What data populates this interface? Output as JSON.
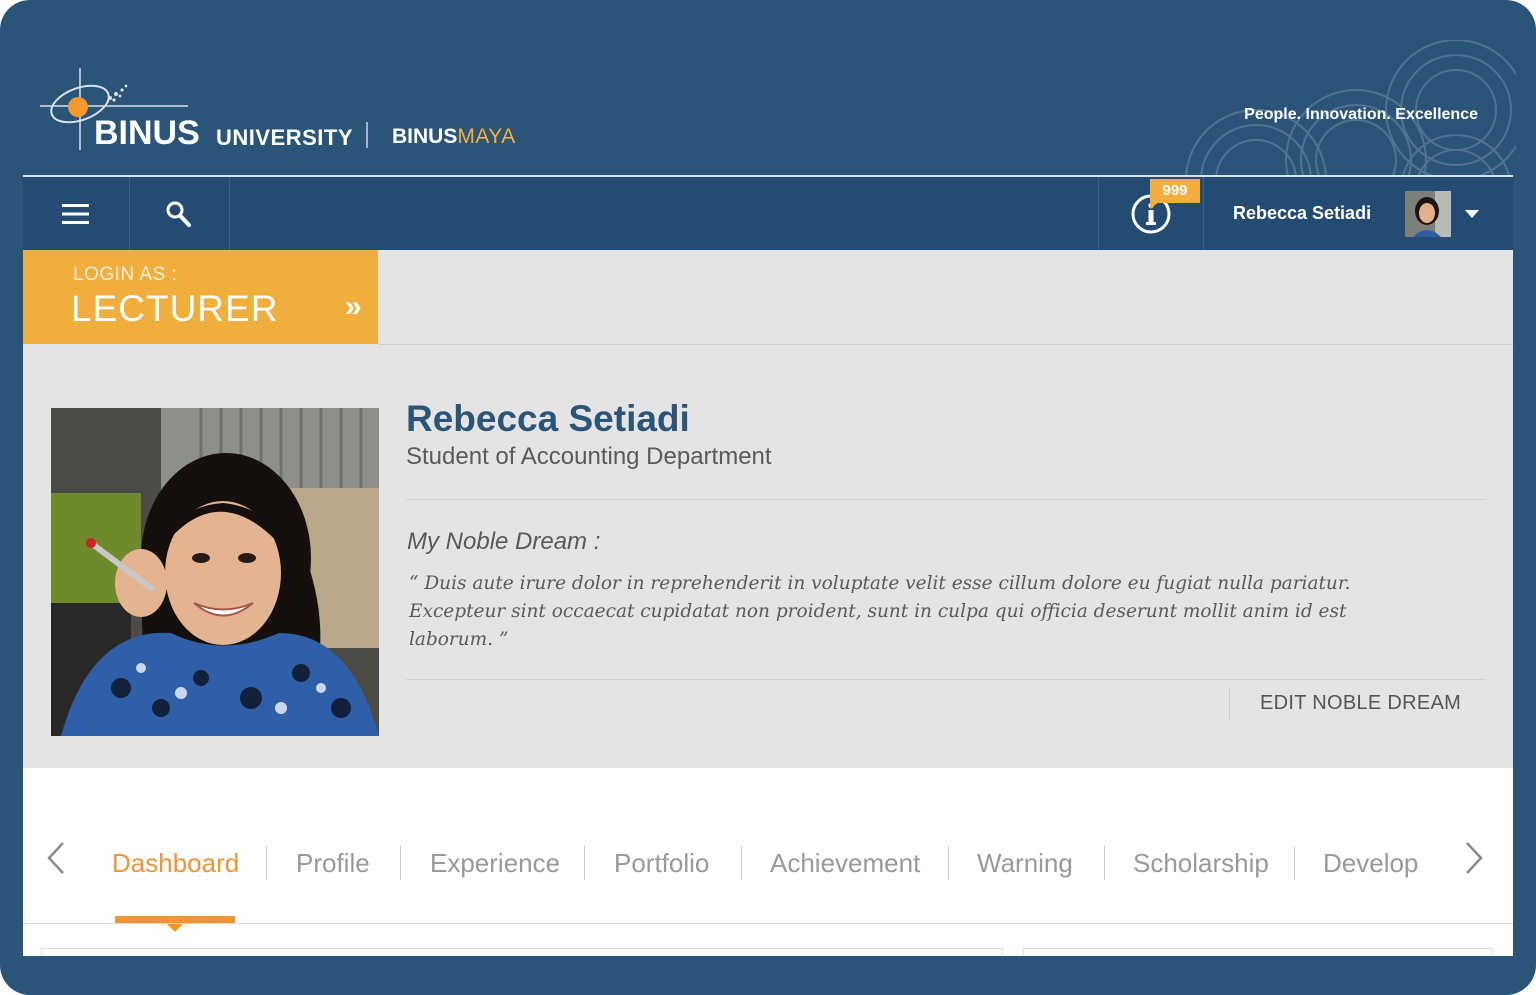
{
  "brand": {
    "name": "BINUS",
    "university": "UNIVERSITY",
    "portal_prefix": "BINUS",
    "portal_suffix": "MAYA",
    "tagline": "People. Innovation. Excellence"
  },
  "topnav": {
    "notification_count": "999",
    "user_name": "Rebecca Setiadi"
  },
  "login": {
    "label": "LOGIN AS :",
    "role": "LECTURER",
    "chevron": "»"
  },
  "profile": {
    "name": "Rebecca Setiadi",
    "department": "Student of Accounting Department",
    "dream_title": "My Noble Dream :",
    "dream_text": "“ Duis aute irure dolor in reprehenderit in voluptate velit esse cillum dolore eu fugiat nulla pariatur. Excepteur sint occaecat cupidatat non proident, sunt in culpa qui officia deserunt mollit anim id est laborum. ”",
    "edit_label": "EDIT NOBLE DREAM"
  },
  "tabs": {
    "items": [
      "Dashboard",
      "Profile",
      "Experience",
      "Portfolio",
      "Achievement",
      "Warning",
      "Scholarship",
      "Develop"
    ],
    "active": "Dashboard"
  },
  "colors": {
    "header_blue": "#2b5479",
    "nav_blue": "#244c72",
    "accent_orange": "#f0ae3c",
    "tab_active": "#ef9433"
  },
  "icons": {
    "menu": "hamburger-icon",
    "search": "search-icon",
    "info": "info-icon",
    "dropdown": "chevron-down-icon",
    "prev": "chevron-left-icon",
    "next": "chevron-right-icon"
  }
}
